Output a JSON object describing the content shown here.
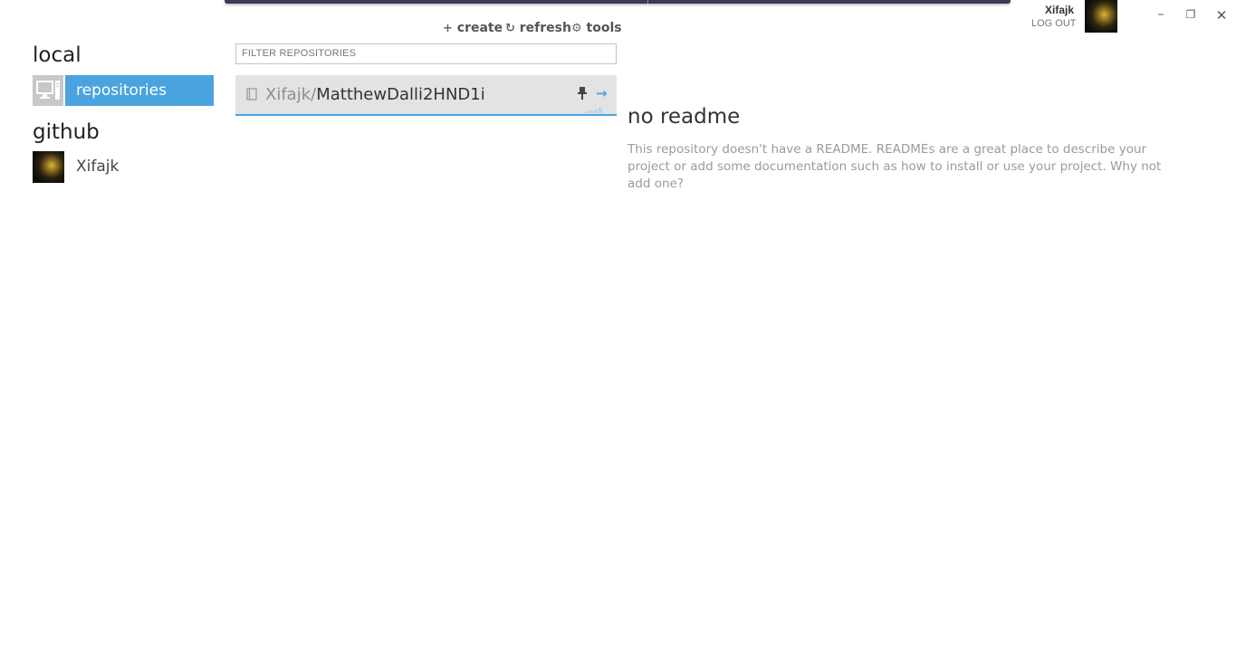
{
  "window": {
    "minimize_glyph": "–",
    "restore_glyph": "❐",
    "close_glyph": "✕"
  },
  "user": {
    "name": "Xifajk",
    "logout_label": "LOG OUT"
  },
  "sidebar": {
    "local_title": "local",
    "local_items": [
      {
        "label": "repositories",
        "icon": "computer-icon",
        "selected": true
      }
    ],
    "github_title": "github",
    "github_items": [
      {
        "label": "Xifajk",
        "icon": "avatar"
      }
    ]
  },
  "toolbar": {
    "create": {
      "icon": "plus-icon",
      "glyph": "+",
      "label": "create"
    },
    "refresh": {
      "icon": "refresh-icon",
      "glyph": "↻",
      "label": "refresh"
    },
    "tools": {
      "icon": "gear-icon",
      "glyph": "⚙",
      "label": "tools"
    }
  },
  "filter": {
    "placeholder": "FILTER REPOSITORIES",
    "value": ""
  },
  "repositories": [
    {
      "owner": "Xifajk",
      "separator": "/",
      "name": "MatthewDalli2HND1i",
      "icon": "book-icon",
      "pin_glyph": "†",
      "open_glyph": "→"
    }
  ],
  "readme": {
    "title": "no readme",
    "body": "This repository doesn't have a README. READMEs are a great place to describe your project or add some documentation such as how to install or use your project. Why not add one?"
  },
  "colors": {
    "accent": "#4aa3df",
    "selected_row": "#e3e3e3"
  }
}
